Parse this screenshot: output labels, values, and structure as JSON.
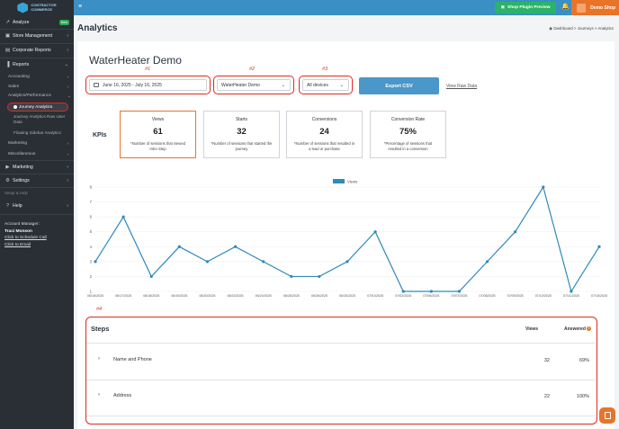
{
  "sidebar": {
    "logo_text": [
      "CONTRACTOR",
      "COMMERCE"
    ],
    "analyze": "Analyze",
    "new_badge": "New",
    "store_mgmt": "Store Management",
    "corporate_reports": "Corporate Reports",
    "reports": "Reports",
    "accounting": "Accounting",
    "sales": "Sales",
    "analytics_performance": "Analytics/Performance",
    "journey_analytics": "Journey Analytics",
    "journey_raw": "Journey Analytics Raw User Data",
    "floating_sidebar": "Floating Sidebar Analytics",
    "marketing_sub": "Marketing",
    "miscellaneous": "Miscellaneous",
    "marketing": "Marketing",
    "settings": "Settings",
    "setup_help": "Setup & Help",
    "help": "Help",
    "account_manager_label": "Account Manager:",
    "account_manager_name": "Traci Monson",
    "schedule_call": "Click to Schedule Call",
    "email": "Click to Email"
  },
  "topbar": {
    "plugin_preview": "Shop Plugin Preview",
    "demo_shop": "Demo Shop"
  },
  "header": {
    "title": "Analytics",
    "breadcrumb": "Dashboard  >  Journeys  >  Analytics"
  },
  "main": {
    "journey_title": "WaterHeater Demo",
    "markers": [
      "#1",
      "#2",
      "#3",
      "#4"
    ],
    "date_range": "June 16, 2025 - July 16, 2025",
    "journey_select": "WaterHeater Demo",
    "device_select": "All devices",
    "export_label": "Export CSV",
    "raw_link": "View Raw Data",
    "kpis_label": "KPIs",
    "kpis": [
      {
        "title": "Views",
        "value": "61",
        "desc": "*Number of sessions that viewed Intro Step"
      },
      {
        "title": "Starts",
        "value": "32",
        "desc": "*Number of sessions that started the journey"
      },
      {
        "title": "Conversions",
        "value": "24",
        "desc": "*Number of sessions that resulted in a lead or purchase"
      },
      {
        "title": "Conversion Rate",
        "value": "75%",
        "desc": "*Percentage of sessions that resulted in a conversion"
      }
    ],
    "steps": {
      "title": "Steps",
      "views_header": "Views",
      "answered_header": "Answered",
      "rows": [
        {
          "name": "Name and Phone",
          "views": "32",
          "answered": "69%"
        },
        {
          "name": "Address",
          "views": "22",
          "answered": "100%"
        }
      ]
    }
  },
  "chart_data": {
    "type": "line",
    "series": [
      {
        "name": "Views",
        "values": [
          3,
          6,
          2,
          4,
          3,
          4,
          3,
          2,
          2,
          3,
          5,
          1,
          1,
          1,
          3,
          5,
          8,
          1,
          4
        ]
      }
    ],
    "categories": [
      "06/16/2025",
      "06/17/2025",
      "06/18/2025",
      "06/19/2025",
      "06/20/2025",
      "06/23/2025",
      "06/24/2025",
      "06/25/2025",
      "06/26/2025",
      "06/30/2025",
      "07/01/2025",
      "07/02/2025",
      "07/06/2025",
      "07/07/2025",
      "07/08/2025",
      "07/09/2025",
      "07/10/2025",
      "07/11/2025",
      "07/15/2025"
    ],
    "ylim": [
      1,
      8
    ],
    "yticks": [
      "1",
      "2",
      "3",
      "4",
      "5",
      "6",
      "7",
      "8"
    ],
    "legend": "top-center",
    "color": "#2f8ab8",
    "grid": true
  }
}
